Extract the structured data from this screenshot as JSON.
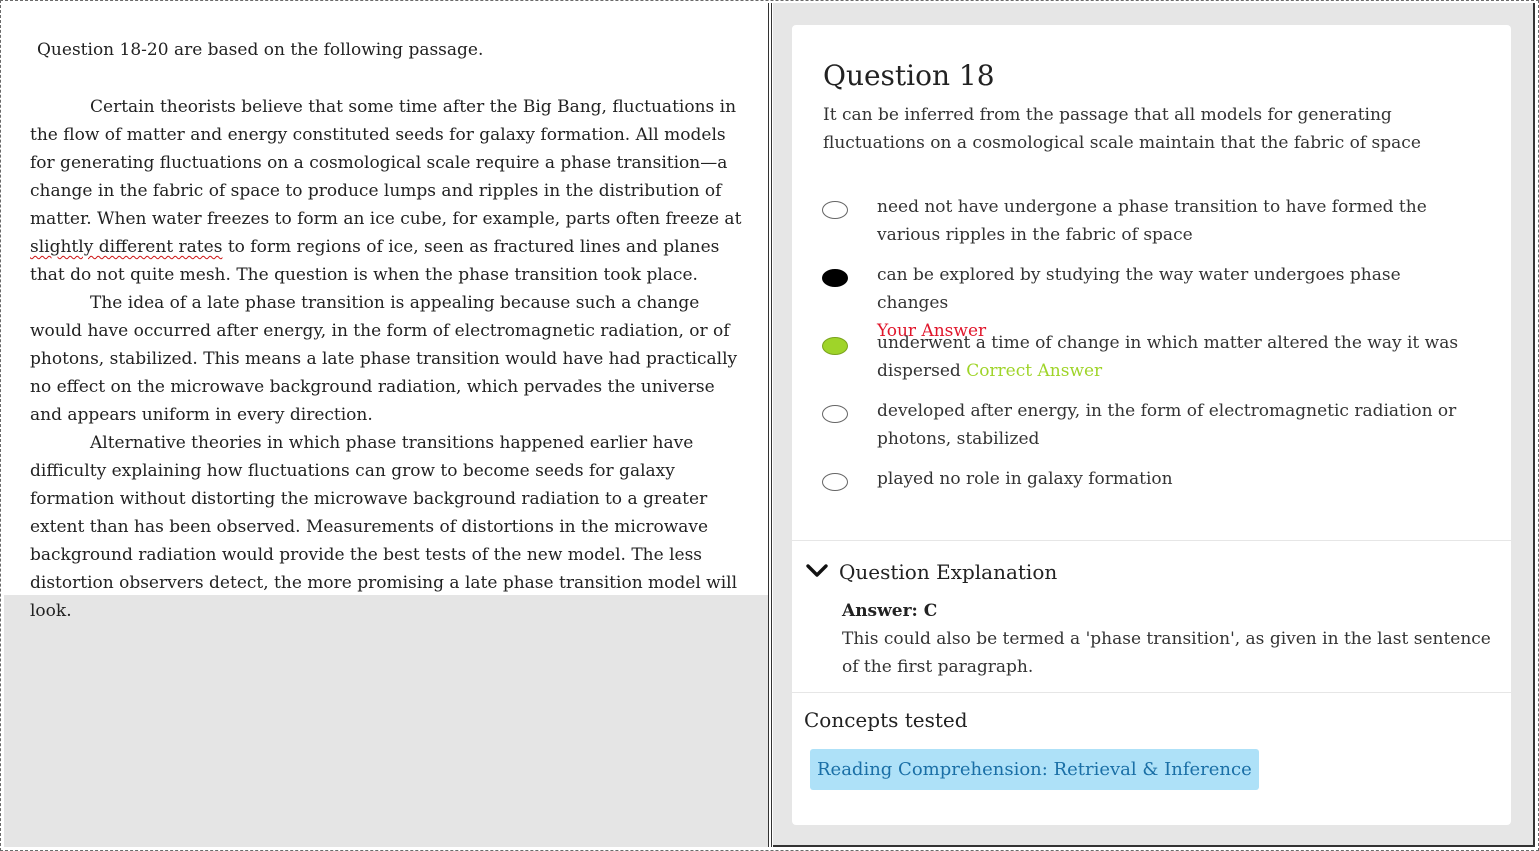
{
  "passage": {
    "intro": "Question 18-20 are based on the following passage.",
    "p1_before": "Certain theorists believe that some time after the Big Bang, fluctuations in the flow of matter and energy constituted seeds for galaxy formation. All models for generating fluctuations on a cosmological scale require a phase transition—a change in the fabric of space to produce lumps and ripples in the distribution of matter. When water freezes to form an ice cube, for example, parts often freeze at ",
    "p1_marked": "slightly different rates",
    "p1_after": " to form regions of ice, seen as fractured lines and planes that do not quite mesh. The question is when the phase transition took place.",
    "p2": "The idea of a late phase transition is appealing because such a change would have occurred after energy, in the form of electromagnetic radiation, or of photons, stabilized. This means a late phase transition would have had practically no effect on the microwave background radiation, which pervades the universe and appears uniform in every direction.",
    "p3": "Alternative theories in which phase transitions happened earlier have difficulty explaining how fluctuations can grow to become seeds for galaxy formation without distorting the microwave background radiation to a greater extent than has been observed. Measurements of distortions in the microwave background radiation would provide the best tests of the new model. The less distortion observers detect, the more promising a late phase transition model will look."
  },
  "question": {
    "title": "Question 18",
    "prompt": "It can be inferred from the passage that all models for generating fluctuations on a cosmological scale maintain that the fabric of space",
    "choices": [
      {
        "text": "need not have undergone a phase transition to have formed the various ripples in the fabric of space",
        "state": "empty"
      },
      {
        "text": "can be explored by studying the way water undergoes phase changes",
        "state": "selected",
        "tag": "Your Answer"
      },
      {
        "text": "underwent a time of change in which matter altered the way it was dispersed",
        "state": "correct",
        "tag": "Correct Answer"
      },
      {
        "text": "developed after energy, in the form of electromagnetic radiation or photons, stabilized",
        "state": "empty"
      },
      {
        "text": "played no role in galaxy formation",
        "state": "empty"
      }
    ]
  },
  "explanation": {
    "title": "Question Explanation",
    "answer": "Answer: C",
    "text": "This could also be termed a 'phase transition', as given in the last sentence of the first paragraph."
  },
  "concepts": {
    "label": "Concepts tested",
    "tag": "Reading Comprehension: Retrieval & Inference"
  },
  "colors": {
    "your_answer": "#e0162b",
    "correct_answer": "#9fd429",
    "tag_bg": "#aee1f8",
    "tag_text": "#1a6fa6"
  },
  "icons": {
    "explanation_toggle": "chevron-down-icon"
  }
}
